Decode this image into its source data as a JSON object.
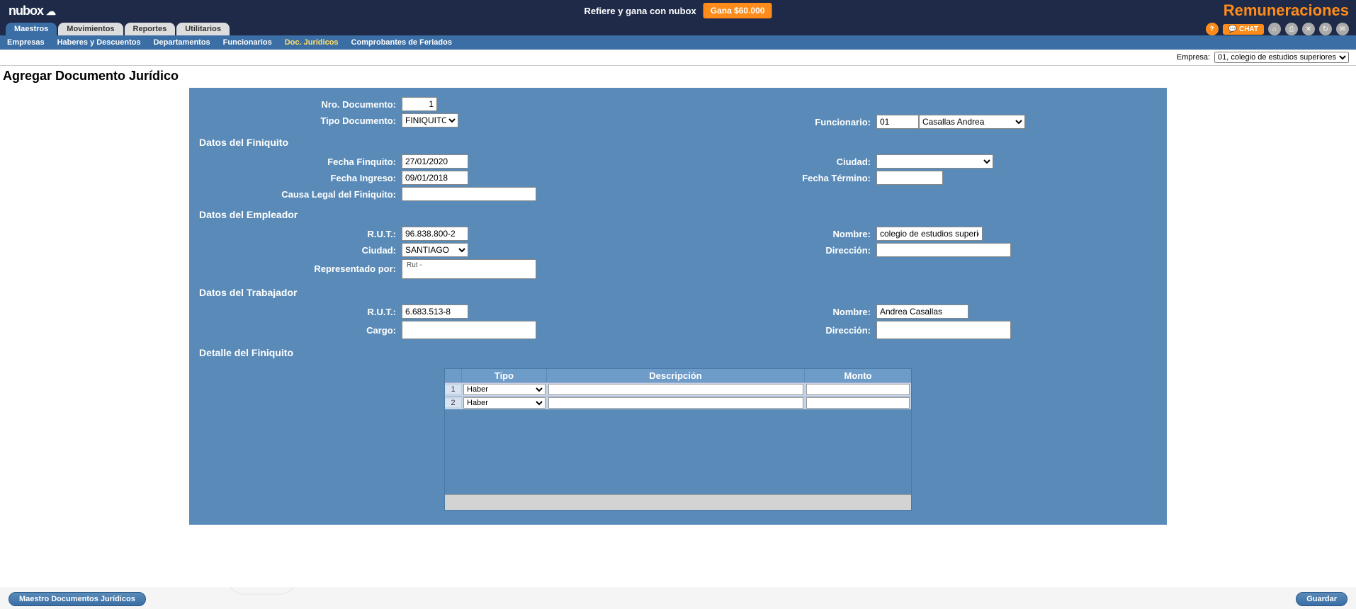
{
  "header": {
    "logo": "nubox",
    "refer_text": "Refiere y gana con nubox",
    "refer_button": "Gana $60.000",
    "app_name": "Remuneraciones",
    "chat_label": "CHAT"
  },
  "tabs": {
    "items": [
      "Maestros",
      "Movimientos",
      "Reportes",
      "Utilitarios"
    ],
    "active": 0
  },
  "subtabs": {
    "items": [
      "Empresas",
      "Haberes y Descuentos",
      "Departamentos",
      "Funcionarios",
      "Doc. Jurídicos",
      "Comprobantes de Feriados"
    ],
    "active": 4
  },
  "company": {
    "label": "Empresa:",
    "selected": "01, colegio de estudios superiores"
  },
  "page_title": "Agregar Documento Jurídico",
  "form": {
    "nro_doc_label": "Nro. Documento:",
    "nro_doc_value": "1",
    "tipo_doc_label": "Tipo Documento:",
    "tipo_doc_value": "FINIQUITO",
    "funcionario_label": "Funcionario:",
    "funcionario_code": "01",
    "funcionario_name": "Casallas Andrea",
    "sec_finiquito": "Datos del Finiquito",
    "fecha_finiquito_label": "Fecha Finquito:",
    "fecha_finiquito_value": "27/01/2020",
    "ciudad_label": "Ciudad:",
    "ciudad_value": "",
    "fecha_ingreso_label": "Fecha Ingreso:",
    "fecha_ingreso_value": "09/01/2018",
    "fecha_termino_label": "Fecha Término:",
    "fecha_termino_value": "",
    "causa_legal_label": "Causa Legal del Finiquito:",
    "causa_legal_value": "",
    "sec_empleador": "Datos del Empleador",
    "emp_rut_label": "R.U.T.:",
    "emp_rut_value": "96.838.800-2",
    "emp_nombre_label": "Nombre:",
    "emp_nombre_value": "colegio de estudios superiores",
    "emp_ciudad_label": "Ciudad:",
    "emp_ciudad_value": "SANTIAGO",
    "emp_direccion_label": "Dirección:",
    "emp_direccion_value": "",
    "representado_label": "Representado por:",
    "representado_value": "Rut  -",
    "sec_trabajador": "Datos del Trabajador",
    "trab_rut_label": "R.U.T.:",
    "trab_rut_value": "6.683.513-8",
    "trab_nombre_label": "Nombre:",
    "trab_nombre_value": "Andrea Casallas",
    "trab_cargo_label": "Cargo:",
    "trab_cargo_value": "",
    "trab_direccion_label": "Dirección:",
    "trab_direccion_value": "",
    "sec_detalle": "Detalle del Finiquito"
  },
  "detail_table": {
    "headers": {
      "tipo": "Tipo",
      "descripcion": "Descripción",
      "monto": "Monto"
    },
    "rows": [
      {
        "n": "1",
        "tipo": "Haber",
        "descripcion": "",
        "monto": ""
      },
      {
        "n": "2",
        "tipo": "Haber",
        "descripcion": "",
        "monto": ""
      }
    ]
  },
  "bottom": {
    "left_button": "Maestro Documentos Jurídicos",
    "right_button": "Guardar"
  }
}
